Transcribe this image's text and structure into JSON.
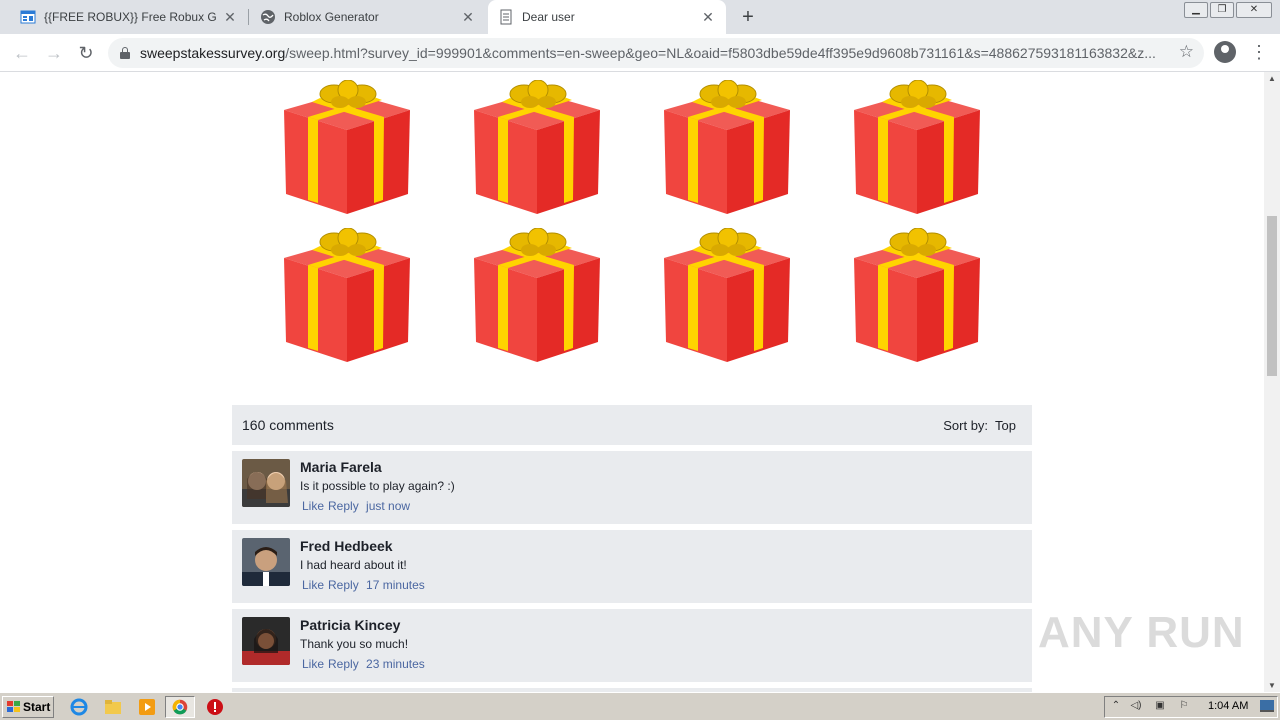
{
  "browser": {
    "tabs": [
      {
        "title": "{{FREE ROBUX}} Free Robux Generat",
        "active": false
      },
      {
        "title": "Roblox Generator",
        "active": false
      },
      {
        "title": "Dear user",
        "active": true
      }
    ],
    "url_domain": "sweepstakessurvey.org",
    "url_path": "/sweep.html?survey_id=999901&comments=en-sweep&geo=NL&oaid=f5803dbe59de4ff395e9d9608b731161&s=48862759318116383​2&z..."
  },
  "comments_section": {
    "count_label": "160 comments",
    "sort_label": "Sort by:",
    "sort_value": "Top",
    "comments": [
      {
        "name": "Maria Farela",
        "text": "Is it possible to play again? :)",
        "like": "Like",
        "reply": "Reply",
        "time": "just now"
      },
      {
        "name": "Fred Hedbeek",
        "text": "I had heard about it!",
        "like": "Like",
        "reply": "Reply",
        "time": "17 minutes"
      },
      {
        "name": "Patricia Kincey",
        "text": "Thank you so much!",
        "like": "Like",
        "reply": "Reply",
        "time": "23 minutes"
      }
    ]
  },
  "watermark": "ANY RUN",
  "taskbar": {
    "start_label": "Start",
    "clock": "1:04 AM"
  },
  "colors": {
    "gift_red": "#e8332d",
    "gift_ribbon": "#ffd700",
    "comment_bg": "#e9ebee",
    "link_blue": "#4b67a1"
  }
}
